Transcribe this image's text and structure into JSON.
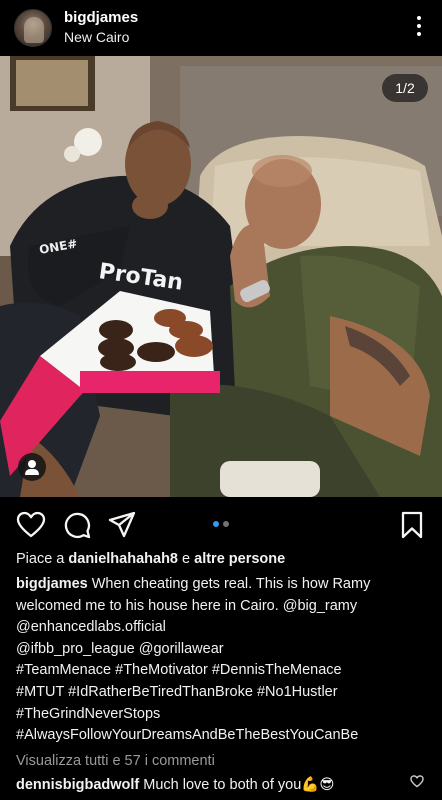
{
  "post": {
    "username": "bigdjames",
    "location": "New Cairo",
    "image_counter": "1/2",
    "carousel": {
      "count": 2,
      "active": 0,
      "active_color": "#3897f0",
      "inactive_color": "#737373"
    }
  },
  "likes": {
    "prefix": "Piace a",
    "user": "danielhahahah8",
    "conj": "e",
    "others": "altre persone"
  },
  "caption": {
    "username": "bigdjames",
    "lines": [
      "When cheating gets real. This is how Ramy",
      "welcomed me to his house here in Cairo. @big_ramy",
      "@enhancedlabs.official",
      "@ifbb_pro_league  @gorillawear",
      "#TeamMenace #TheMotivator #DennisTheMenace",
      "#MTUT #IdRatherBeTiredThanBroke #No1Hustler",
      "#TheGrindNeverStops",
      "#AlwaysFollowYourDreamsAndBeTheBestYouCanBe"
    ]
  },
  "comments": {
    "view_all": "Visualizza tutti e 57 i commenti",
    "preview": {
      "username": "dennisbigbadwolf",
      "text": "Much love to both of you💪😎"
    }
  },
  "icons": {
    "more": "more-options-icon",
    "like": "heart-icon",
    "comment": "comment-icon",
    "share": "share-icon",
    "save": "bookmark-icon",
    "tags": "user-tag-icon"
  }
}
